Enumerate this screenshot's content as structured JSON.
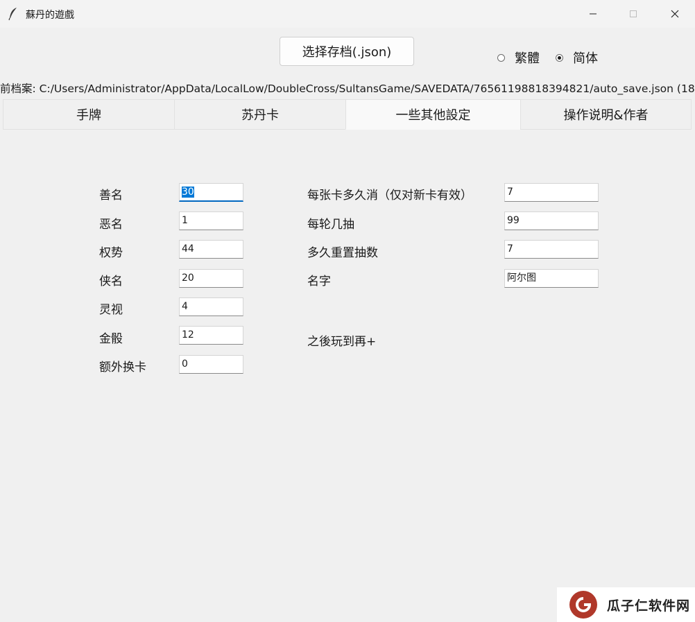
{
  "window": {
    "title": "蘇丹的遊戲"
  },
  "toolbar": {
    "load_button": "选择存档(.json)",
    "lang_traditional": "繁體",
    "lang_simplified": "简体",
    "lang_selected": "简体"
  },
  "save_path": "前档案: C:/Users/Administrator/AppData/LocalLow/DoubleCross/SultansGame/SAVEDATA/76561198818394821/auto_save.json (18:",
  "tabs": [
    "手牌",
    "苏丹卡",
    "一些其他設定",
    "操作说明&作者"
  ],
  "active_tab": "一些其他設定",
  "left_fields": [
    {
      "label": "善名",
      "value": "30"
    },
    {
      "label": "恶名",
      "value": "1"
    },
    {
      "label": "权势",
      "value": "44"
    },
    {
      "label": "侠名",
      "value": "20"
    },
    {
      "label": "灵视",
      "value": "4"
    },
    {
      "label": "金骰",
      "value": "12"
    },
    {
      "label": "额外换卡",
      "value": "0"
    }
  ],
  "right_fields": [
    {
      "label": "每张卡多久消（仅对新卡有效）",
      "value": "7"
    },
    {
      "label": "每轮几抽",
      "value": "99"
    },
    {
      "label": "多久重置抽数",
      "value": "7"
    },
    {
      "label": "名字",
      "value": "阿尔图"
    }
  ],
  "note": "之後玩到再+",
  "watermark": "瓜子仁软件网",
  "colors": {
    "accent": "#0078d7",
    "watermark_logo": "#b0382a"
  }
}
